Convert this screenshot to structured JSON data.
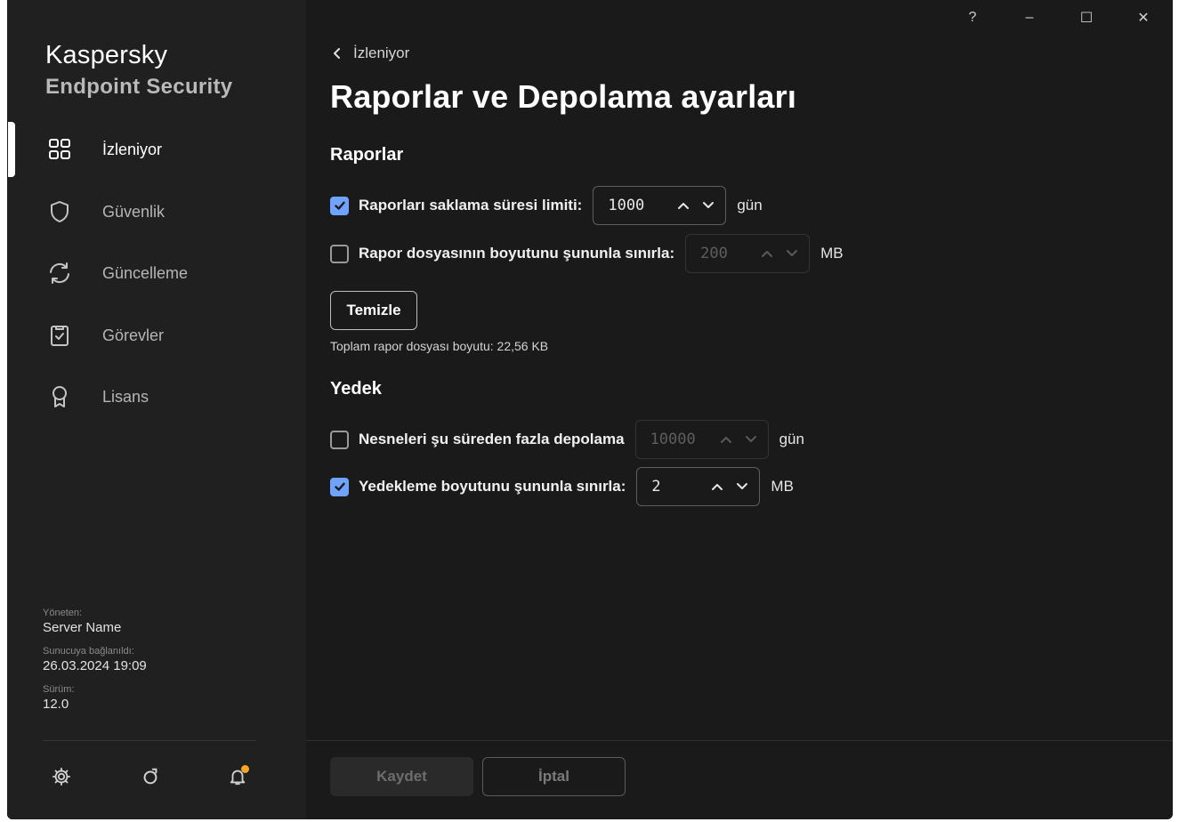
{
  "app": {
    "brand_line1": "Kaspersky",
    "brand_line2": "Endpoint Security"
  },
  "titlebar": {
    "help": "?",
    "minimize": "–",
    "maximize": "☐",
    "close": "✕"
  },
  "sidebar": {
    "items": [
      {
        "label": "İzleniyor",
        "icon": "grid-icon",
        "active": true
      },
      {
        "label": "Güvenlik",
        "icon": "shield-icon",
        "active": false
      },
      {
        "label": "Güncelleme",
        "icon": "refresh-icon",
        "active": false
      },
      {
        "label": "Görevler",
        "icon": "clipboard-check-icon",
        "active": false
      },
      {
        "label": "Lisans",
        "icon": "award-icon",
        "active": false
      }
    ],
    "meta": {
      "managed_by_label": "Yöneten:",
      "managed_by_value": "Server Name",
      "connected_label": "Sunucuya bağlanıldı:",
      "connected_value": "26.03.2024 19:09",
      "version_label": "Sürüm:",
      "version_value": "12.0"
    },
    "bottom_icons": [
      "settings-icon",
      "support-icon",
      "notification-bell-icon"
    ]
  },
  "main": {
    "back_label": "İzleniyor",
    "title": "Raporlar ve Depolama ayarları",
    "reports": {
      "section_title": "Raporlar",
      "limit_days": {
        "label": "Raporları saklama süresi limiti:",
        "checked": true,
        "value": "1000",
        "unit": "gün"
      },
      "limit_size": {
        "label": "Rapor dosyasının boyutunu şununla sınırla:",
        "checked": false,
        "value": "200",
        "unit": "MB"
      },
      "clear_button": "Temizle",
      "total_size_note": "Toplam rapor dosyası boyutu: 22,56 KB"
    },
    "backup": {
      "section_title": "Yedek",
      "store_days": {
        "label": "Nesneleri şu süreden fazla depolama",
        "checked": false,
        "value": "10000",
        "unit": "gün"
      },
      "limit_size": {
        "label": "Yedekleme boyutunu şununla sınırla:",
        "checked": true,
        "value": "2",
        "unit": "MB"
      }
    }
  },
  "footer": {
    "save_label": "Kaydet",
    "cancel_label": "İptal"
  },
  "colors": {
    "accent": "#6fa3ff",
    "background": "#1a1a1a",
    "sidebar": "#202020",
    "notification": "#f5a623"
  }
}
